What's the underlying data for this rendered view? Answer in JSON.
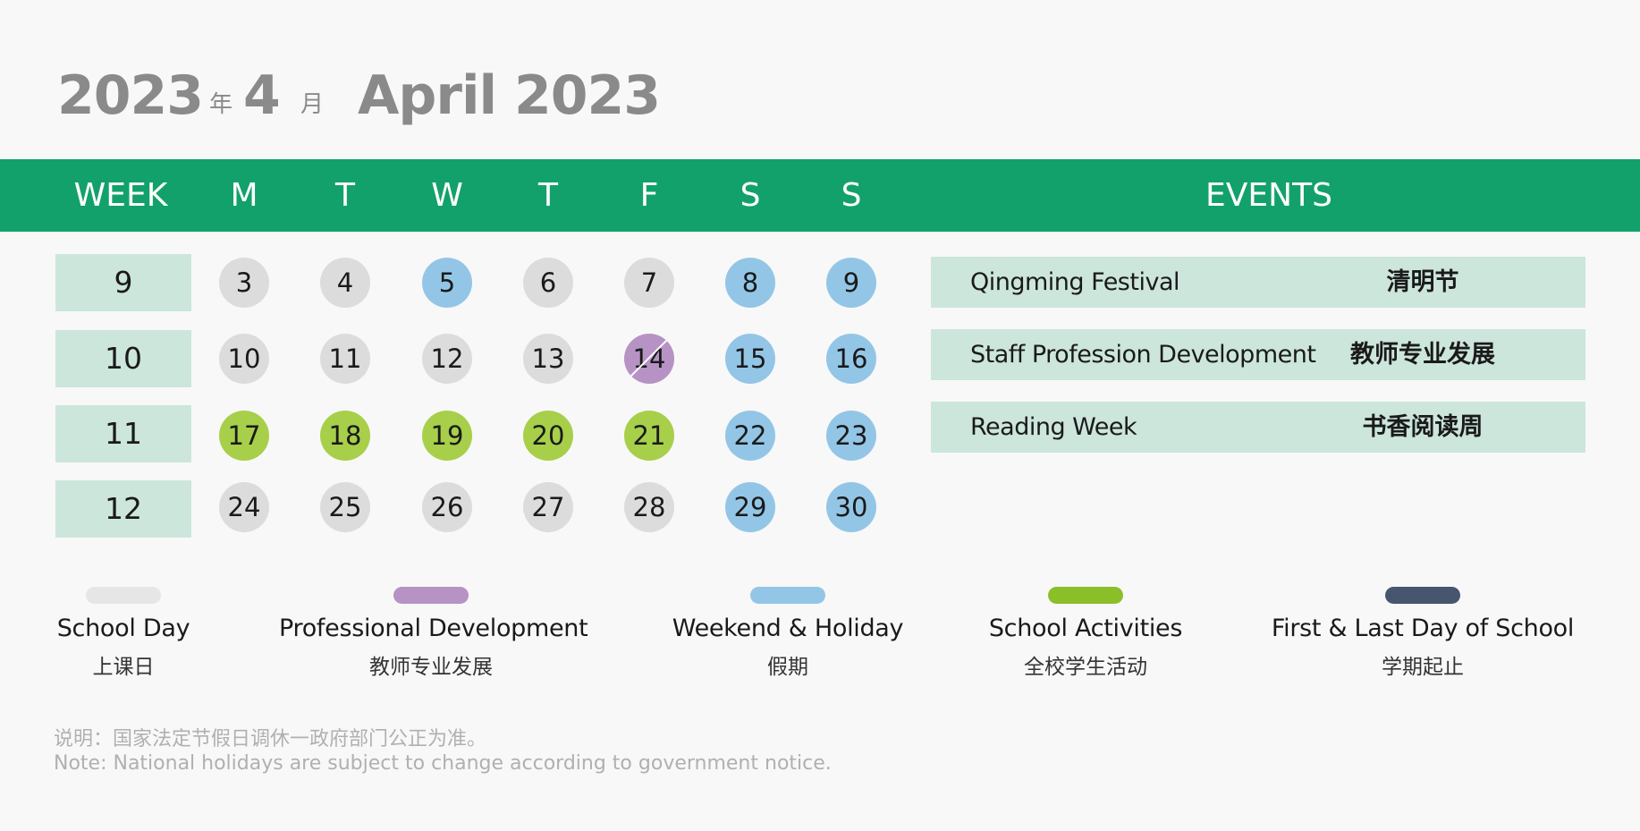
{
  "title": {
    "year": "2023",
    "nian": "年",
    "month": "4",
    "yue": "月",
    "english": "April 2023"
  },
  "header": {
    "week": "WEEK",
    "days": [
      "M",
      "T",
      "W",
      "T",
      "F",
      "S",
      "S"
    ],
    "events": "EVENTS"
  },
  "weeks": [
    {
      "number": "9",
      "days": [
        {
          "label": "3",
          "type": "school"
        },
        {
          "label": "4",
          "type": "school"
        },
        {
          "label": "5",
          "type": "weekend"
        },
        {
          "label": "6",
          "type": "school"
        },
        {
          "label": "7",
          "type": "school"
        },
        {
          "label": "8",
          "type": "weekend"
        },
        {
          "label": "9",
          "type": "weekend"
        }
      ]
    },
    {
      "number": "10",
      "days": [
        {
          "label": "10",
          "type": "school"
        },
        {
          "label": "11",
          "type": "school"
        },
        {
          "label": "12",
          "type": "school"
        },
        {
          "label": "13",
          "type": "school"
        },
        {
          "label": "14",
          "type": "prof",
          "crossed": true
        },
        {
          "label": "15",
          "type": "weekend"
        },
        {
          "label": "16",
          "type": "weekend"
        }
      ]
    },
    {
      "number": "11",
      "days": [
        {
          "label": "17",
          "type": "activity"
        },
        {
          "label": "18",
          "type": "activity"
        },
        {
          "label": "19",
          "type": "activity"
        },
        {
          "label": "20",
          "type": "activity"
        },
        {
          "label": "21",
          "type": "activity"
        },
        {
          "label": "22",
          "type": "weekend"
        },
        {
          "label": "23",
          "type": "weekend"
        }
      ]
    },
    {
      "number": "12",
      "days": [
        {
          "label": "24",
          "type": "school"
        },
        {
          "label": "25",
          "type": "school"
        },
        {
          "label": "26",
          "type": "school"
        },
        {
          "label": "27",
          "type": "school"
        },
        {
          "label": "28",
          "type": "school"
        },
        {
          "label": "29",
          "type": "weekend"
        },
        {
          "label": "30",
          "type": "weekend"
        }
      ]
    }
  ],
  "events": [
    {
      "en": "Qingming Festival",
      "zh": "清明节"
    },
    {
      "en": "Staff Profession Development",
      "zh": "教师专业发展"
    },
    {
      "en": "Reading Week",
      "zh": "书香阅读周"
    }
  ],
  "legend": [
    {
      "en": "School Day",
      "zh": "上课日",
      "color": "#e6e6e6"
    },
    {
      "en": "Professional Development",
      "zh": "教师专业发展",
      "color": "#b792c4"
    },
    {
      "en": "Weekend & Holiday",
      "zh": "假期",
      "color": "#93c6e6"
    },
    {
      "en": "School Activities",
      "zh": "全校学生活动",
      "color": "#8bbf2a"
    },
    {
      "en": "First & Last Day of School",
      "zh": "学期起止",
      "color": "#46566e"
    }
  ],
  "note": {
    "zh": "说明：国家法定节假日调休一政府部门公正为准。",
    "en": "Note: National holidays are subject to change according to government notice."
  },
  "colors": {
    "header_green": "#13a16b",
    "week_box": "#cce6dc",
    "school_day": "#dcdcdc",
    "weekend_holiday": "#93c6e6",
    "school_activities": "#a7cf4a",
    "professional_development": "#b792c4"
  }
}
